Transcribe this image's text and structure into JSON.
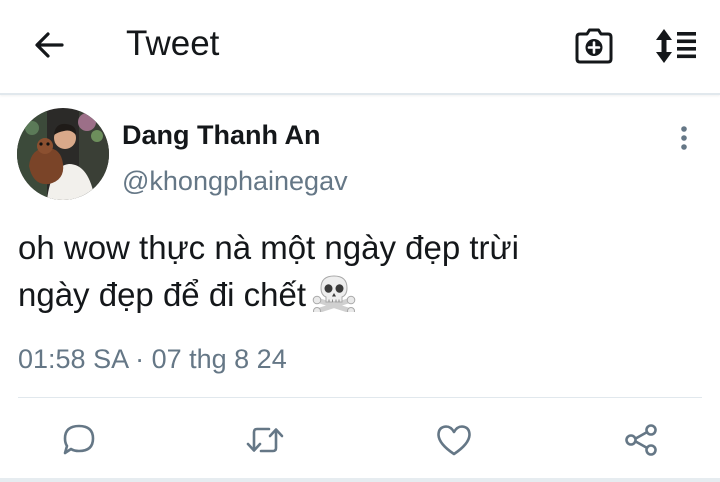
{
  "header": {
    "title": "Tweet",
    "back_icon": "arrow-left-icon",
    "camera_icon": "camera-plus-icon",
    "sort_icon": "sort-list-icon"
  },
  "tweet": {
    "author_name": "Dang Thanh An",
    "author_handle": "@khongphainegav",
    "text_line_1": "oh wow thực nà một ngày đẹp trừi",
    "text_line_2": "ngày đẹp để đi chết",
    "emoji": "skull-and-crossbones-icon",
    "timestamp": "01:58 SA · 07 thg 8 24"
  },
  "actions": [
    "reply-icon",
    "retweet-icon",
    "like-icon",
    "share-icon"
  ],
  "colors": {
    "text_primary": "#14171a",
    "text_secondary": "#657786",
    "divider": "#e1e8ed",
    "icon": "#657786"
  }
}
